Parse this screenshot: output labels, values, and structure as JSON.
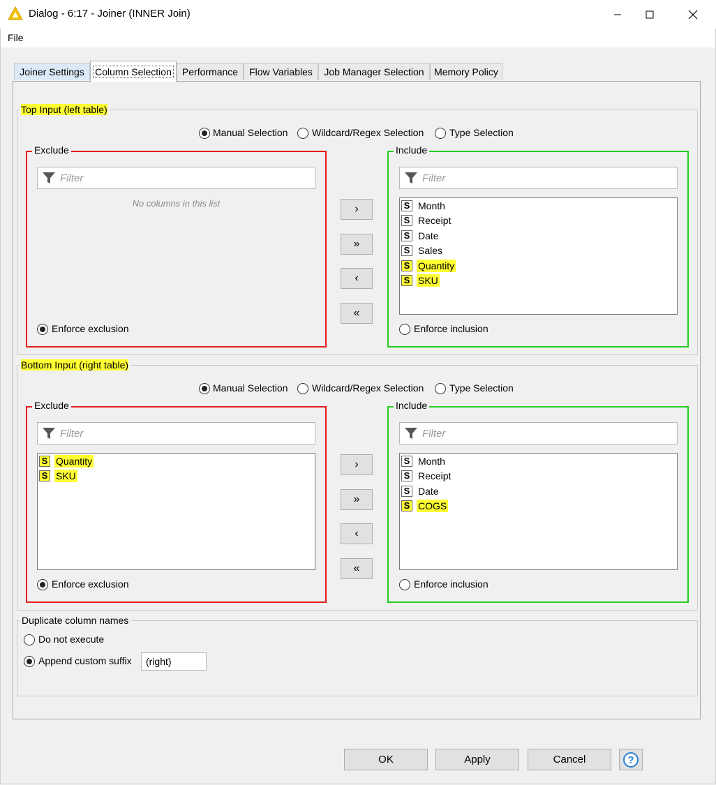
{
  "window": {
    "title": "Dialog - 6:17 - Joiner (INNER Join)",
    "menu_file": "File"
  },
  "tabs": [
    {
      "label": "Joiner Settings"
    },
    {
      "label": "Column Selection",
      "active": true
    },
    {
      "label": "Performance"
    },
    {
      "label": "Flow Variables"
    },
    {
      "label": "Job Manager Selection"
    },
    {
      "label": "Memory Policy"
    }
  ],
  "top": {
    "title": "Top Input (left table)",
    "modes": [
      "Manual Selection",
      "Wildcard/Regex Selection",
      "Type Selection"
    ],
    "selected_mode": "Manual Selection",
    "exclude": {
      "title": "Exclude",
      "filter_placeholder": "Filter",
      "empty_text": "No columns in this list",
      "items": [],
      "enforce_label": "Enforce exclusion",
      "enforce_selected": true
    },
    "include": {
      "title": "Include",
      "filter_placeholder": "Filter",
      "items": [
        {
          "type": "S",
          "name": "Month",
          "highlight": false
        },
        {
          "type": "S",
          "name": "Receipt",
          "highlight": false
        },
        {
          "type": "S",
          "name": "Date",
          "highlight": false
        },
        {
          "type": "S",
          "name": "Sales",
          "highlight": false
        },
        {
          "type": "S",
          "name": "Quantity",
          "highlight": true
        },
        {
          "type": "S",
          "name": "SKU",
          "highlight": true
        }
      ],
      "enforce_label": "Enforce inclusion",
      "enforce_selected": false
    }
  },
  "bottom": {
    "title": "Bottom Input (right table)",
    "modes": [
      "Manual Selection",
      "Wildcard/Regex Selection",
      "Type Selection"
    ],
    "selected_mode": "Manual Selection",
    "exclude": {
      "title": "Exclude",
      "filter_placeholder": "Filter",
      "items": [
        {
          "type": "S",
          "name": "Quantity",
          "highlight": true
        },
        {
          "type": "S",
          "name": "SKU",
          "highlight": true
        }
      ],
      "enforce_label": "Enforce exclusion",
      "enforce_selected": true
    },
    "include": {
      "title": "Include",
      "filter_placeholder": "Filter",
      "items": [
        {
          "type": "S",
          "name": "Month",
          "highlight": false
        },
        {
          "type": "S",
          "name": "Receipt",
          "highlight": false
        },
        {
          "type": "S",
          "name": "Date",
          "highlight": false
        },
        {
          "type": "S",
          "name": "COGS",
          "highlight": true
        }
      ],
      "enforce_label": "Enforce inclusion",
      "enforce_selected": false
    }
  },
  "move_buttons": [
    "›",
    "»",
    "‹",
    "«"
  ],
  "duplicates": {
    "title": "Duplicate column names",
    "options": [
      "Do not execute",
      "Append custom suffix"
    ],
    "selected": "Append custom suffix",
    "suffix_value": "(right)"
  },
  "buttons": {
    "ok": "OK",
    "apply": "Apply",
    "cancel": "Cancel"
  },
  "colors": {
    "highlight": "#ffff33",
    "exclude_border": "#e41c1c",
    "include_border": "#22cc22"
  }
}
